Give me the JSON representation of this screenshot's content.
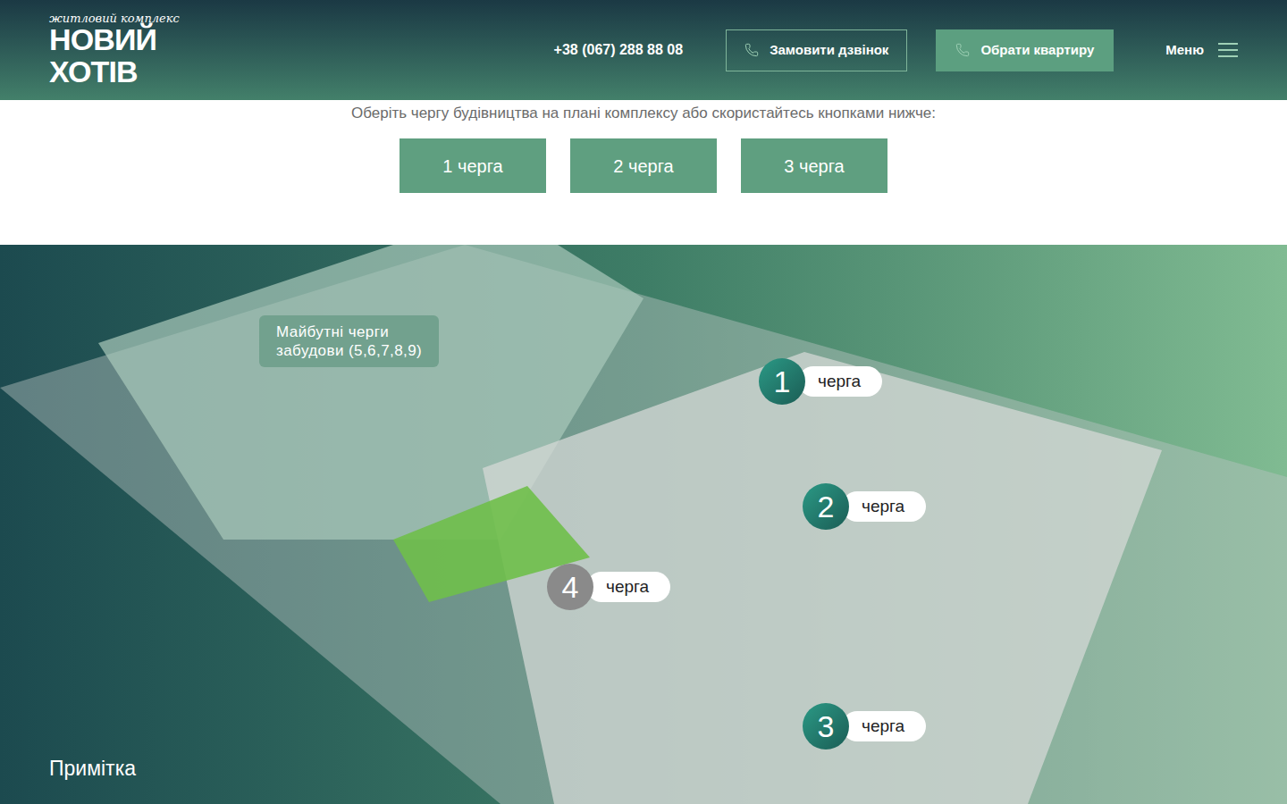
{
  "header": {
    "logo": {
      "tagline": "житловий комплекс",
      "name": "НОВИЙ ХОТІВ"
    },
    "phone": "+38 (067) 288 88 08",
    "buttons": [
      {
        "label": "Замовити дзвінок",
        "kind": "outline"
      },
      {
        "label": "Обрати квартиру",
        "kind": "filled"
      }
    ],
    "menu": "Меню"
  },
  "phases": {
    "hint": "Оберіть чергу будівництва на плані комплексу або скористайтесь кнопками нижче:",
    "buttons": [
      "1 черга",
      "2 черга",
      "3 черга"
    ]
  },
  "plan": {
    "future_label": [
      "Майбутні черги",
      "забудови (5,6,7,8,9)"
    ],
    "pins": [
      {
        "number": "1",
        "label": "черга",
        "active": true
      },
      {
        "number": "2",
        "label": "черга",
        "active": true
      },
      {
        "number": "4",
        "label": "черга",
        "active": false
      },
      {
        "number": "3",
        "label": "черга",
        "active": true
      }
    ],
    "note": "Примітка"
  }
}
